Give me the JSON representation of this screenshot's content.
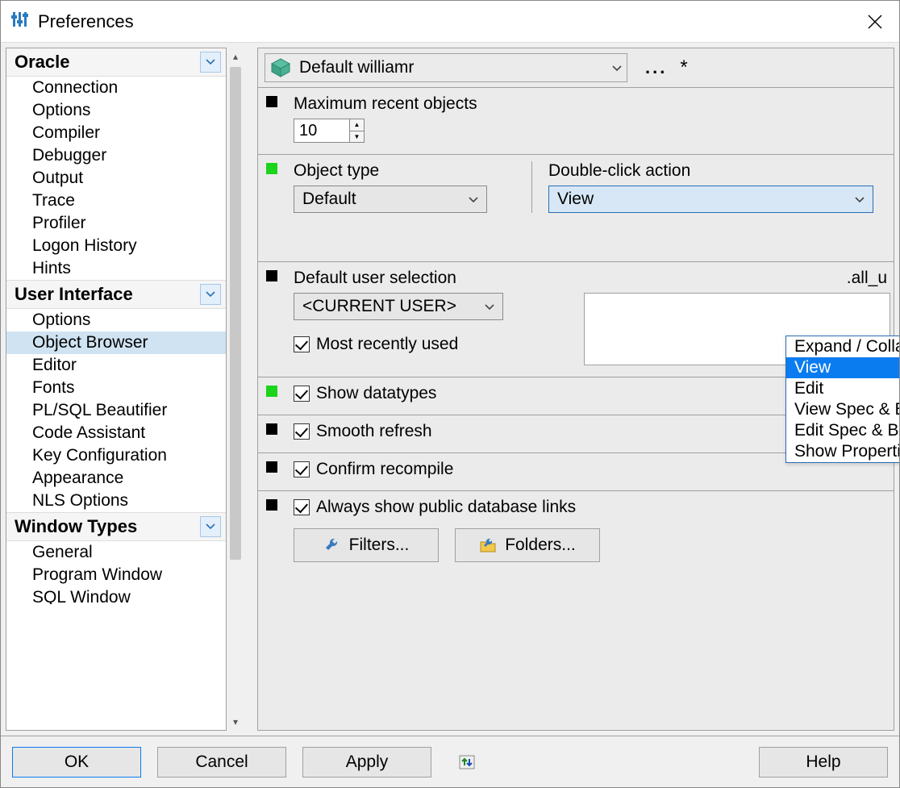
{
  "window": {
    "title": "Preferences"
  },
  "sidebar": {
    "categories": [
      {
        "label": "Oracle",
        "items": [
          "Connection",
          "Options",
          "Compiler",
          "Debugger",
          "Output",
          "Trace",
          "Profiler",
          "Logon History",
          "Hints"
        ]
      },
      {
        "label": "User Interface",
        "items": [
          "Options",
          "Object Browser",
          "Editor",
          "Fonts",
          "PL/SQL Beautifier",
          "Code Assistant",
          "Key Configuration",
          "Appearance",
          "NLS Options"
        ],
        "selected_index": 1
      },
      {
        "label": "Window Types",
        "items": [
          "General",
          "Program Window",
          "SQL Window"
        ]
      }
    ]
  },
  "profile": {
    "name": "Default williamr",
    "dirty_mark": "*",
    "ellipsis": "..."
  },
  "settings": {
    "max_recent_label": "Maximum recent objects",
    "max_recent_value": "10",
    "object_type_label": "Object type",
    "object_type_value": "Default",
    "dblclick_label": "Double-click action",
    "dblclick_value": "View",
    "dblclick_options": [
      "Expand / Collapse",
      "View",
      "Edit",
      "View Spec & Body",
      "Edit Spec & Body",
      "Show Properties"
    ],
    "dblclick_highlight_index": 1,
    "default_user_label": "Default user selection",
    "default_user_value": "<CURRENT USER>",
    "obscured_right_text": ".all_u",
    "most_recently_used": "Most recently used",
    "show_datatypes": "Show datatypes",
    "smooth_refresh": "Smooth refresh",
    "confirm_recompile": "Confirm recompile",
    "always_links": "Always show public database links",
    "filters_btn": "Filters...",
    "folders_btn": "Folders..."
  },
  "footer": {
    "ok": "OK",
    "cancel": "Cancel",
    "apply": "Apply",
    "help": "Help"
  }
}
